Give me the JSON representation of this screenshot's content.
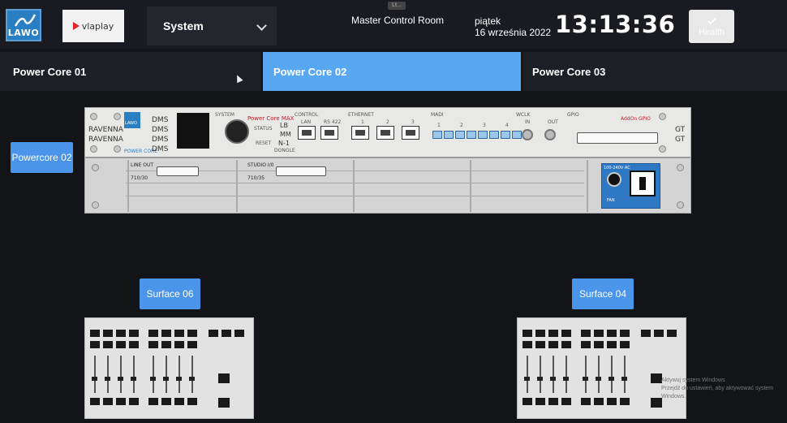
{
  "header": {
    "logo_text": "LAWO",
    "brand_text": "vlaplay",
    "system_select_value": "System",
    "room_title": "Master Control Room",
    "day_name": "piątek",
    "date": "16 września 2022",
    "time": "13:13:36",
    "health_label": "Health",
    "magnifier_text": "Lt..."
  },
  "tabs": [
    {
      "label": "Power Core 01",
      "active": false
    },
    {
      "label": "Power Core 02",
      "active": true
    },
    {
      "label": "Power Core 03",
      "active": false
    }
  ],
  "device": {
    "label_button": "Powercore 02",
    "ravenna_1": "RAVENNA",
    "ravenna_2": "RAVENNA",
    "dms": [
      "DMS",
      "DMS",
      "DMS",
      "DMS"
    ],
    "brand": "LAWO",
    "brand_sub": "POWER CORE",
    "system_label": "SYSTEM",
    "model": "Power Core MAX",
    "status": "STATUS",
    "reset": "RESET",
    "dongle": "DONGLE",
    "lb_mm_n1": [
      "LB",
      "MM",
      "N-1"
    ],
    "control_label": "CONTROL",
    "control_ports": [
      "LAN",
      "RS 422"
    ],
    "ethernet_label": "ETHERNET",
    "ethernet_ports": [
      "1",
      "2",
      "3"
    ],
    "madi_label": "MADI",
    "madi_ports": [
      "1",
      "2",
      "3",
      "4"
    ],
    "wclk_label": "WCLK",
    "wclk_ports": [
      "IN",
      "OUT"
    ],
    "gpio_label": "GPIO",
    "addon": "AddOn GPIO",
    "gt": [
      "GT",
      "GT"
    ],
    "line_out": "LINE OUT",
    "line_out_code": "710/30",
    "studio_io": "STUDIO I/0",
    "studio_code": "710/35",
    "psu_label": "100-240V AC",
    "psu_fan": "FAN"
  },
  "surfaces": [
    {
      "label": "Surface 06"
    },
    {
      "label": "Surface 04"
    }
  ],
  "watermark": {
    "line1": "Aktywuj system Windows",
    "line2": "Przejdź do ustawień, aby aktywować system Windows."
  },
  "colors": {
    "accent": "#58a7f2",
    "button_blue": "#4a95ea",
    "background": "#121418"
  }
}
